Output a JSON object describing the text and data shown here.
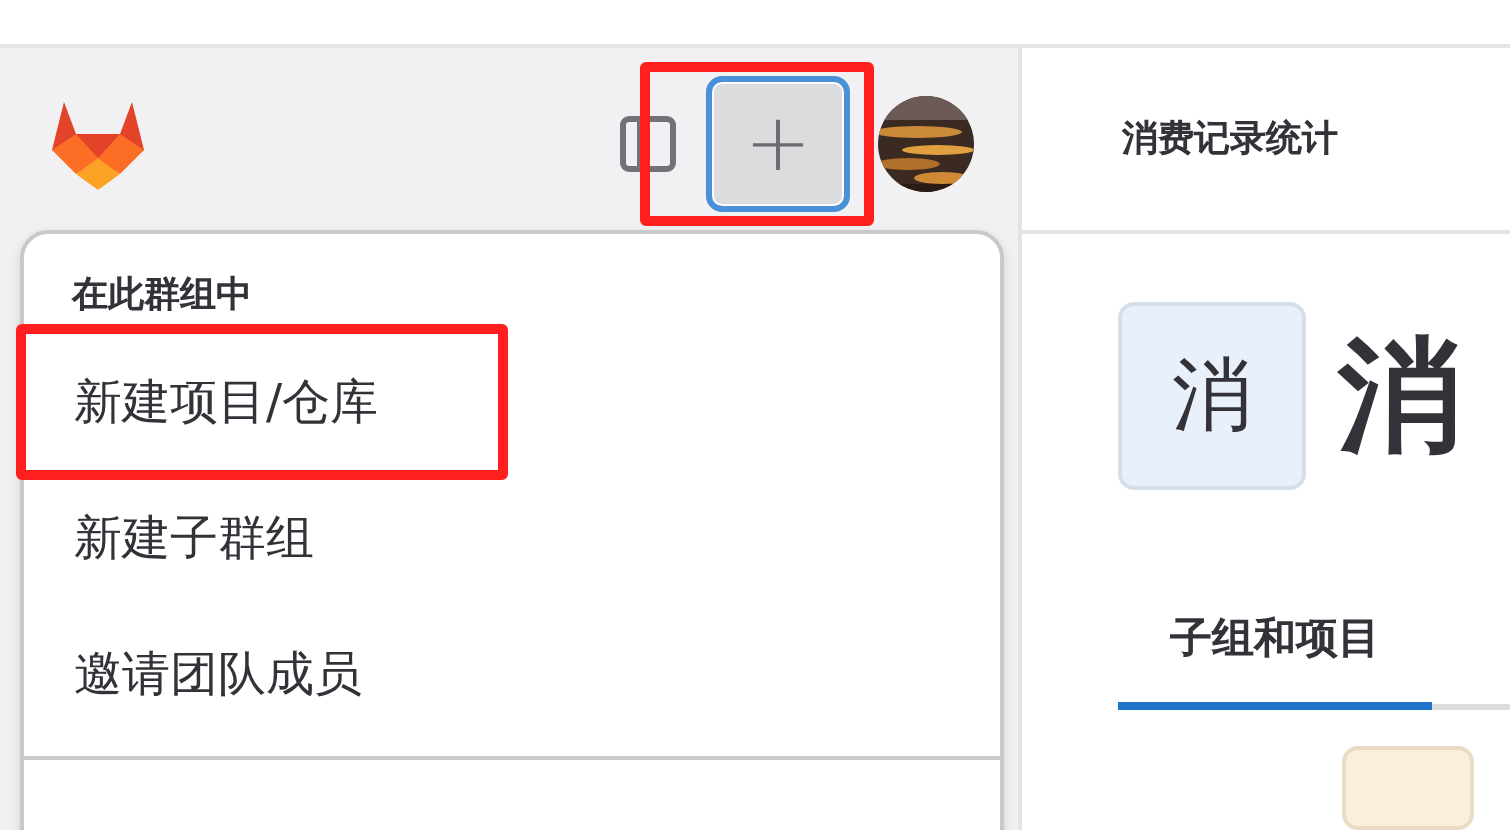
{
  "sidebar": {
    "new_button": {
      "label": "+",
      "highlighted": true
    }
  },
  "new_menu": {
    "sections": [
      {
        "heading": "在此群组中",
        "items": [
          {
            "label": "新建项目/仓库",
            "highlighted": true
          },
          {
            "label": "新建子群组",
            "highlighted": false
          },
          {
            "label": "邀请团队成员",
            "highlighted": false
          }
        ]
      }
    ]
  },
  "breadcrumb": "消费记录统计",
  "group": {
    "avatar_letter": "消",
    "title": "消"
  },
  "tabs": [
    {
      "label": "子组和项目",
      "selected": true
    }
  ]
}
